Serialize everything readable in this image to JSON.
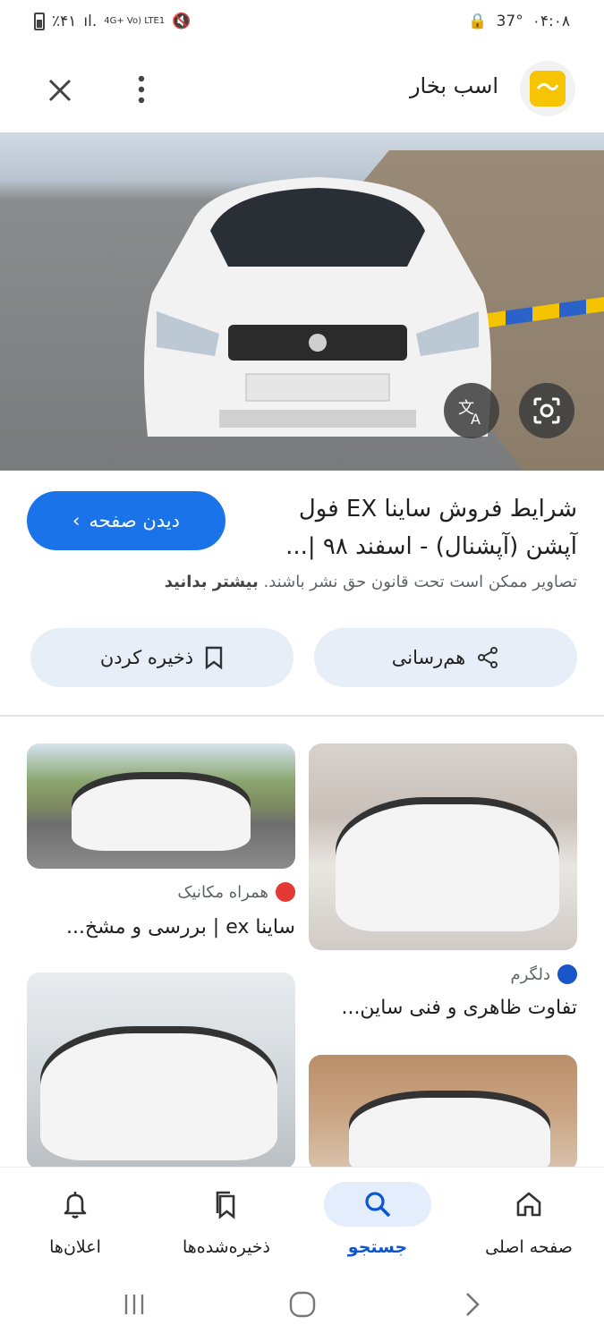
{
  "status_bar": {
    "battery": "٪۴۱",
    "signal": "4G+ Vo) LTE1",
    "temperature": "37°",
    "time": "۰۴:۰۸"
  },
  "app_bar": {
    "site_title": "اسب بخار"
  },
  "result": {
    "title": "شرایط فروش ساینا EX فول آپشن (آپشنال) - اسفند ۹۸ |...",
    "visit_button": "دیدن صفحه",
    "copyright_text": "تصاویر ممکن است تحت قانون حق نشر باشند.",
    "learn_more": "بیشتر بدانید",
    "share_label": "هم‌رسانی",
    "save_label": "ذخیره کردن"
  },
  "related": [
    {
      "source": "دلگرم",
      "caption": "تفاوت ظاهری و فنی ساین..."
    },
    {
      "source": "همراه مکانیک",
      "caption": "ساینا ex | بررسی و مشخ..."
    }
  ],
  "bottom_nav": {
    "home": "صفحه اصلی",
    "search": "جستجو",
    "saved": "ذخیره‌شده‌ها",
    "notifications": "اعلان‌ها"
  },
  "colors": {
    "accent": "#1a73e8",
    "pill_bg": "#e8eef8",
    "nav_active_bg": "#e3edfb"
  }
}
